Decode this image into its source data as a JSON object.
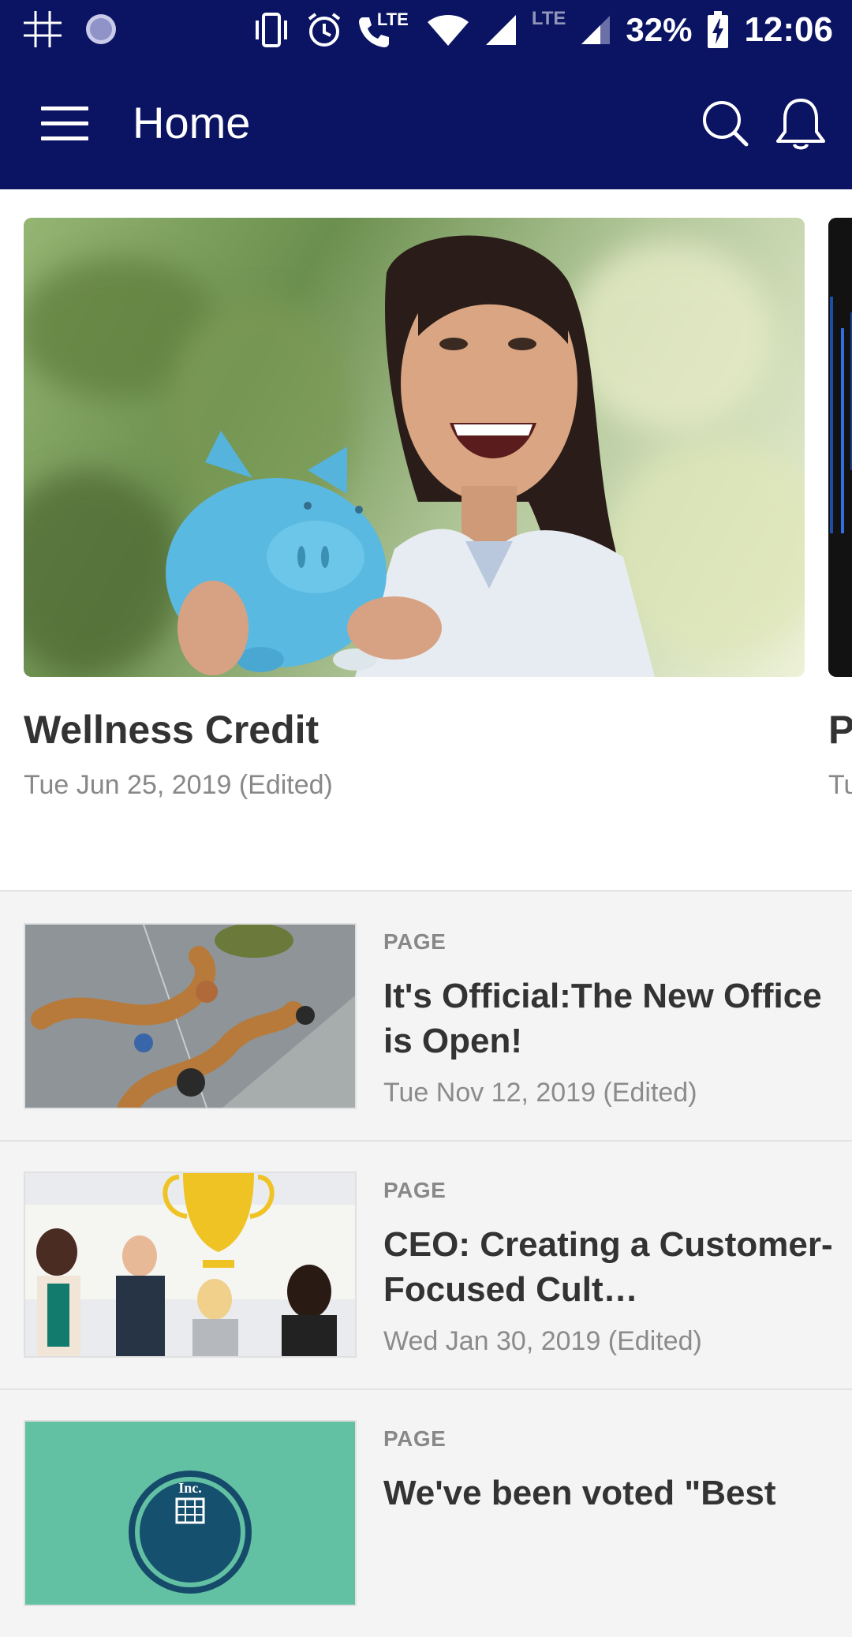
{
  "status_bar": {
    "battery": "32%",
    "time": "12:06",
    "lte_label": "LTE",
    "call_lte_label": "LTE",
    "icons": [
      "sudoku-grid-icon",
      "moon-icon",
      "vibrate-icon",
      "alarm-icon",
      "wifi-calling-icon",
      "wifi-icon",
      "signal-icon",
      "signal-icon",
      "battery-charging-icon"
    ]
  },
  "app_bar": {
    "title": "Home",
    "background": "#0b1463"
  },
  "featured": [
    {
      "title": "Wellness Credit",
      "date": "Tue Jun 25, 2019 (Edited)"
    },
    {
      "title": "P",
      "date": "Tu"
    }
  ],
  "list": [
    {
      "kind": "PAGE",
      "title": "It's Official:The New Office is Open!",
      "date": "Tue Nov 12, 2019 (Edited)"
    },
    {
      "kind": "PAGE",
      "title": "CEO: Creating a Customer-Focused Cult…",
      "date": "Wed Jan 30, 2019 (Edited)"
    },
    {
      "kind": "PAGE",
      "title": "We've been voted \"Best",
      "date": ""
    }
  ],
  "badge": {
    "text": "Inc."
  }
}
